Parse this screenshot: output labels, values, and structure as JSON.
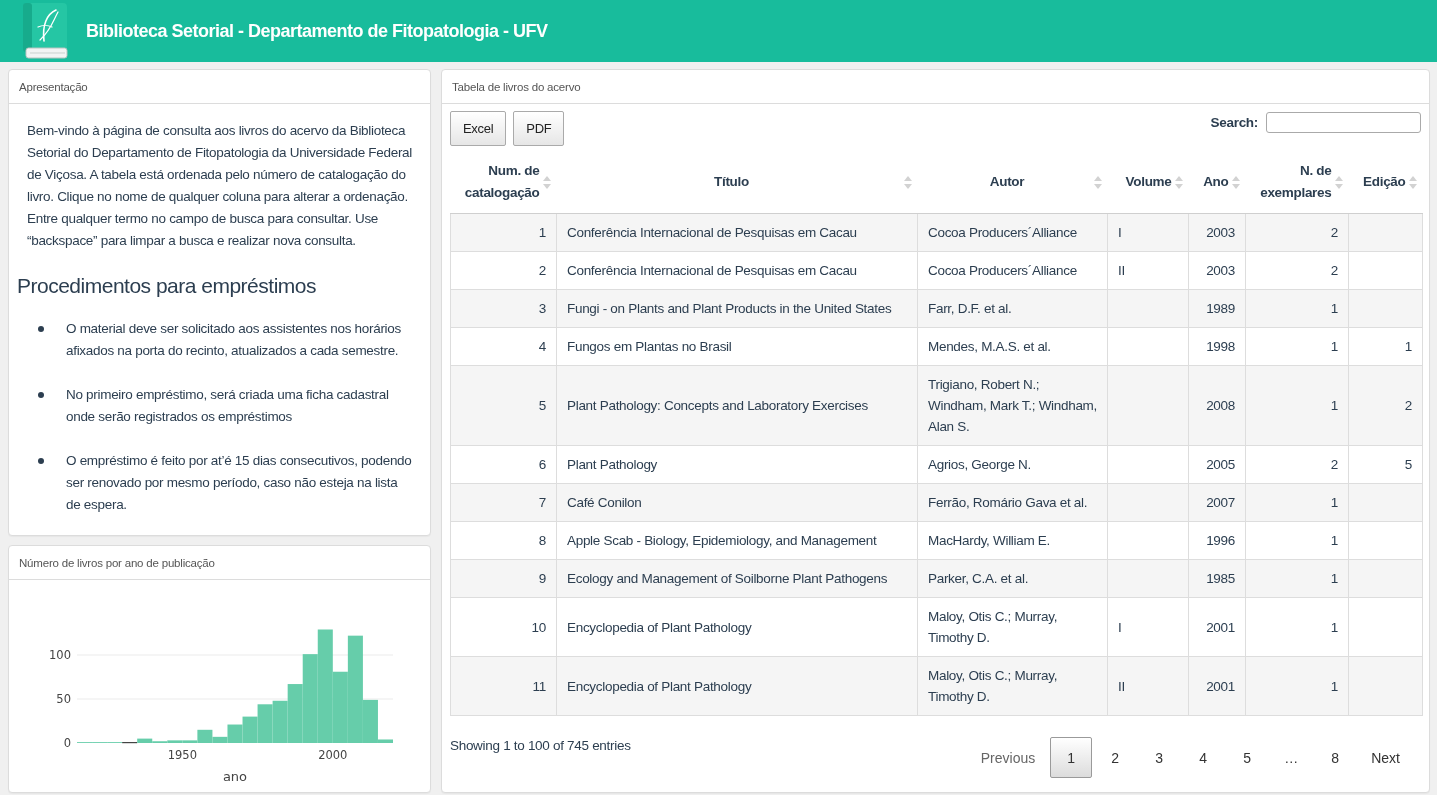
{
  "header": {
    "title": "Biblioteca Setorial - Departamento de Fitopatologia - UFV"
  },
  "intro_panel": {
    "title": "Apresentação",
    "paragraph": "Bem-vindo à página de consulta aos livros do acervo da Biblioteca Setorial do Departamento de Fitopatologia da Universidade Federal de Viçosa. A tabela está ordenada pelo número de catalogação do livro. Clique no nome de qualquer coluna para alterar a ordenação. Entre qualquer termo no campo de busca para consultar. Use “backspace” para limpar a busca e realizar nova consulta.",
    "heading": "Procedimentos para empréstimos",
    "items": [
      "O material deve ser solicitado aos assistentes nos horários afixados na porta do recinto, atualizados a cada semestre.",
      "No primeiro empréstimo, será criada uma ficha cadastral onde serão registrados os empréstimos",
      "O empréstimo é feito por at’é 15 dias consecutivos, podendo ser renovado por mesmo período, caso não esteja na lista de espera."
    ]
  },
  "chart_panel": {
    "title": "Número de livros por ano de publicação",
    "chart_data": {
      "type": "bar",
      "xlabel": "ano",
      "x": [
        1917.5,
        1922.5,
        1927.5,
        1932.5,
        1937.5,
        1942.5,
        1947.5,
        1952.5,
        1957.5,
        1962.5,
        1967.5,
        1972.5,
        1977.5,
        1982.5,
        1987.5,
        1992.5,
        1997.5,
        2002.5,
        2007.5,
        2012.5,
        2017.5
      ],
      "values": [
        1,
        1,
        1,
        0,
        5,
        2,
        3,
        3,
        15,
        7,
        21,
        30,
        44,
        48,
        67,
        101,
        129,
        81,
        122,
        49,
        4
      ],
      "xlim": [
        1915,
        2020
      ],
      "ylim": [
        0,
        129
      ],
      "xticks": [
        1950,
        2000
      ],
      "yticks": [
        0,
        50,
        100
      ]
    }
  },
  "table_panel": {
    "title": "Tabela de livros do acervo",
    "buttons": [
      "Excel",
      "PDF"
    ],
    "search": {
      "label": "Search:"
    },
    "table": {
      "columns": [
        "Num. de catalogação",
        "Título",
        "Autor",
        "Volume",
        "Ano",
        "N. de exemplares",
        "Edição"
      ],
      "rows": [
        {
          "catalog_number": "1",
          "title": "Conferência Internacional de Pesquisas em Cacau",
          "author": "Cocoa Producers´Alliance",
          "volume": "I",
          "year": "2003",
          "copies": "2"
        },
        {
          "catalog_number": "2",
          "title": "Conferência Internacional de Pesquisas em Cacau",
          "author": "Cocoa Producers´Alliance",
          "volume": "II",
          "year": "2003",
          "copies": "2"
        },
        {
          "catalog_number": "3",
          "title": "Fungi - on Plants and Plant Products in the United States",
          "author": "Farr, D.F. et al.",
          "year": "1989",
          "copies": "1"
        },
        {
          "catalog_number": "4",
          "title": "Fungos em Plantas no Brasil",
          "author": "Mendes, M.A.S. et al.",
          "year": "1998",
          "copies": "1",
          "edition": "1"
        },
        {
          "catalog_number": "5",
          "title": "Plant Pathology: Concepts and Laboratory Exercises",
          "author": "Trigiano, Robert N.; Windham, Mark T.; Windham, Alan S.",
          "year": "2008",
          "copies": "1",
          "edition": "2"
        },
        {
          "catalog_number": "6",
          "title": "Plant Pathology",
          "author": "Agrios, George N.",
          "year": "2005",
          "copies": "2",
          "edition": "5"
        },
        {
          "catalog_number": "7",
          "title": "Café Conilon",
          "author": "Ferrão, Romário Gava et al.",
          "year": "2007",
          "copies": "1"
        },
        {
          "catalog_number": "8",
          "title": "Apple Scab - Biology, Epidemiology, and Management",
          "author": "MacHardy, William E.",
          "year": "1996",
          "copies": "1"
        },
        {
          "catalog_number": "9",
          "title": "Ecology and Management of Soilborne Plant Pathogens",
          "author": "Parker, C.A. et al.",
          "year": "1985",
          "copies": "1"
        },
        {
          "catalog_number": "10",
          "title": "Encyclopedia of Plant Pathology",
          "author": "Maloy, Otis C.; Murray, Timothy D.",
          "volume": "I",
          "year": "2001",
          "copies": "1"
        },
        {
          "catalog_number": "11",
          "title": "Encyclopedia of Plant Pathology",
          "author": "Maloy, Otis C.; Murray, Timothy D.",
          "volume": "II",
          "year": "2001",
          "copies": "1"
        }
      ]
    },
    "info": "Showing 1 to 100 of 745 entries",
    "pagination": {
      "previous": {
        "label": "Previous",
        "disabled": true
      },
      "pages": [
        {
          "kind": "page",
          "label": "1",
          "selected": true
        },
        {
          "kind": "page",
          "label": "2",
          "selected": false
        },
        {
          "kind": "page",
          "label": "3",
          "selected": false
        },
        {
          "kind": "page",
          "label": "4",
          "selected": false
        },
        {
          "kind": "page",
          "label": "5",
          "selected": false
        },
        {
          "kind": "ellipsis",
          "label": "…",
          "selected": false
        },
        {
          "kind": "page",
          "label": "8",
          "selected": false
        }
      ],
      "next": {
        "label": "Next",
        "disabled": false
      }
    }
  }
}
